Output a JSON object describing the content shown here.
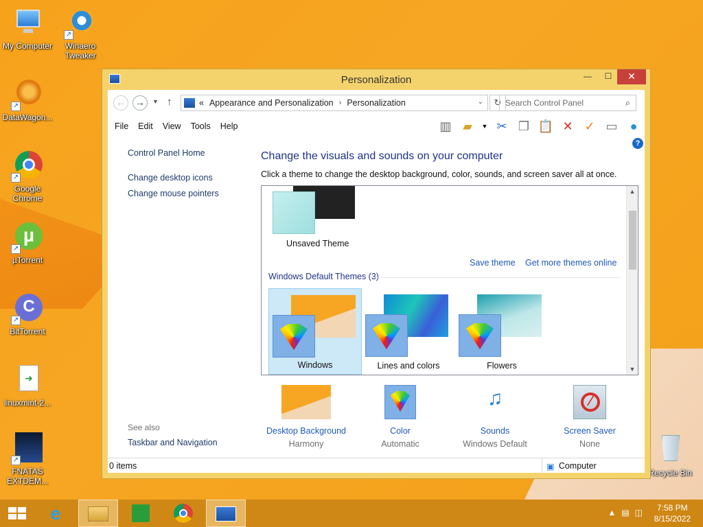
{
  "desktop": {
    "icons": [
      {
        "label": "My Computer"
      },
      {
        "label": "Winaero Tweaker"
      },
      {
        "label": "DataWagon..."
      },
      {
        "label": "Google Chrome"
      },
      {
        "label": "µTorrent"
      },
      {
        "label": "BitTorrent"
      },
      {
        "label": "linuxmint-2..."
      },
      {
        "label": "FNATAS EXTDEM..."
      },
      {
        "label": "Recycle Bin"
      }
    ]
  },
  "window": {
    "title": "Personalization",
    "min_glyph": "—",
    "max_glyph": "☐",
    "close_glyph": "✕"
  },
  "address": {
    "chevrons": "«",
    "crumbs": [
      "Appearance and Personalization",
      "Personalization"
    ],
    "sep": "›",
    "search_placeholder": "Search Control Panel"
  },
  "menu": [
    "File",
    "Edit",
    "View",
    "Tools",
    "Help"
  ],
  "sidebar": {
    "home": "Control Panel Home",
    "links": [
      "Change desktop icons",
      "Change mouse pointers"
    ],
    "see_also": "See also",
    "see_also_links": [
      "Taskbar and Navigation"
    ]
  },
  "main": {
    "heading": "Change the visuals and sounds on your computer",
    "subheading": "Click a theme to change the desktop background, color, sounds, and screen saver all at once.",
    "unsaved_theme": "Unsaved Theme",
    "save_theme": "Save theme",
    "get_more": "Get more themes online",
    "group_title": "Windows Default Themes (3)",
    "themes": [
      {
        "name": "Windows"
      },
      {
        "name": "Lines and colors"
      },
      {
        "name": "Flowers"
      }
    ],
    "options": [
      {
        "label": "Desktop Background",
        "value": "Harmony"
      },
      {
        "label": "Color",
        "value": "Automatic"
      },
      {
        "label": "Sounds",
        "value": "Windows Default"
      },
      {
        "label": "Screen Saver",
        "value": "None"
      }
    ]
  },
  "status": {
    "items": "0 items",
    "location": "Computer"
  },
  "taskbar": {
    "time": "7:58 PM",
    "date": "8/15/2022"
  },
  "colors": {
    "wallpaper": "#f6a623",
    "link": "#1e5ab4",
    "heading": "#1e3287",
    "close": "#c7413a"
  }
}
